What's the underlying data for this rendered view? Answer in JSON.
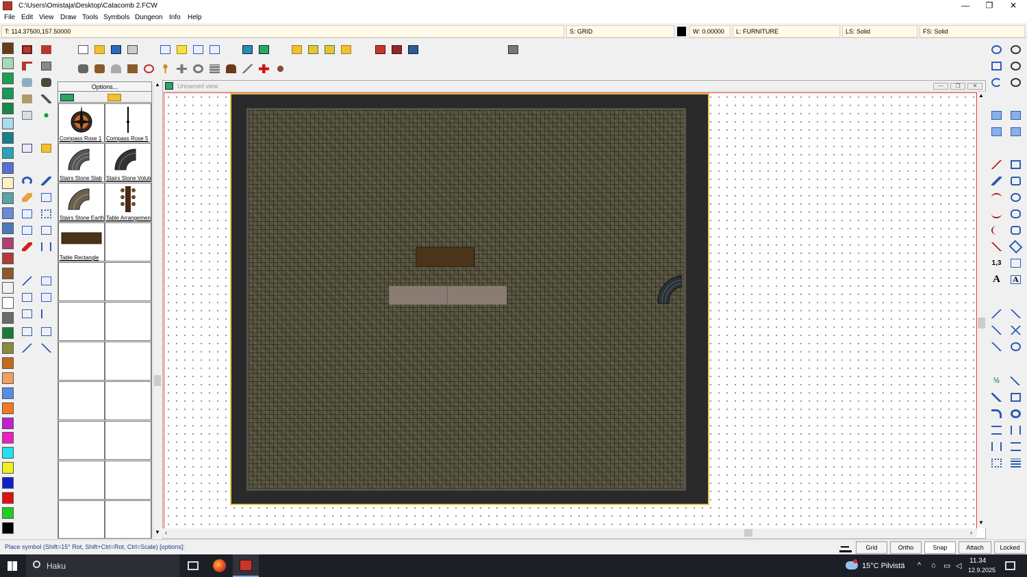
{
  "window": {
    "title": "C:\\Users\\Omistaja\\Desktop\\Catacomb 2.FCW",
    "minimize": "—",
    "maximize": "❐",
    "close": "✕"
  },
  "menu": [
    "File",
    "Edit",
    "View",
    "Draw",
    "Tools",
    "Symbols",
    "Dungeon",
    "Info",
    "Help"
  ],
  "infobar": {
    "coords": "T: 114.37500,157.50000",
    "snap": "S: GRID",
    "width": "W: 0.00000",
    "layer": "L: FURNITURE",
    "line_style": "LS: Solid",
    "fill_style": "FS: Solid"
  },
  "palette_colors": [
    "#6b3a1a",
    "#a7d9b5",
    "#1aa050",
    "#1a9a55",
    "#138a4a",
    "#a8dcea",
    "#1a7d8c",
    "#2aa3b8",
    "#5a6fd0",
    "#fff0c8",
    "#5aa3a8",
    "#6a8bd8",
    "#4a7ab8",
    "#b04070",
    "#b43a3a",
    "#8a5a2a",
    "#f0f0f0",
    "#ffffff",
    "#6a6a6a",
    "#1a7a3a",
    "#8a8a3a",
    "#c46a1a",
    "#f0a060",
    "#5a8ae8",
    "#f07a20",
    "#c020d0",
    "#f020c0",
    "#20e0f0",
    "#f0f020",
    "#1020d0",
    "#e01010",
    "#20d020",
    "#000000"
  ],
  "symbols_panel": {
    "options_label": "Options...",
    "cells": [
      {
        "label": "Compass Rose 1"
      },
      {
        "label": "Compass Rose 5"
      },
      {
        "label": "Stairs Stone Slab"
      },
      {
        "label": "Stairs Stone Volute"
      },
      {
        "label": "Stairs Stone Earth"
      },
      {
        "label": "Table Arrangement"
      },
      {
        "label": "Table Rectangle"
      },
      {
        "label": ""
      }
    ]
  },
  "view": {
    "title": "Unnamed view"
  },
  "status": {
    "message": "Place symbol (Shift=15° Rot, Shift+Ctrl=Rot, Ctrl=Scale) [options]:",
    "buttons": [
      "Grid",
      "Ortho",
      "Snap",
      "Attach",
      "Locked"
    ]
  },
  "taskbar": {
    "search_placeholder": "Haku",
    "weather": "15°C  Pilvistä",
    "time": "11.34",
    "date": "12.9.2025"
  },
  "icons": {
    "compass": "compass-rose-icon",
    "stairs": "stairs-icon",
    "table": "table-icon"
  }
}
